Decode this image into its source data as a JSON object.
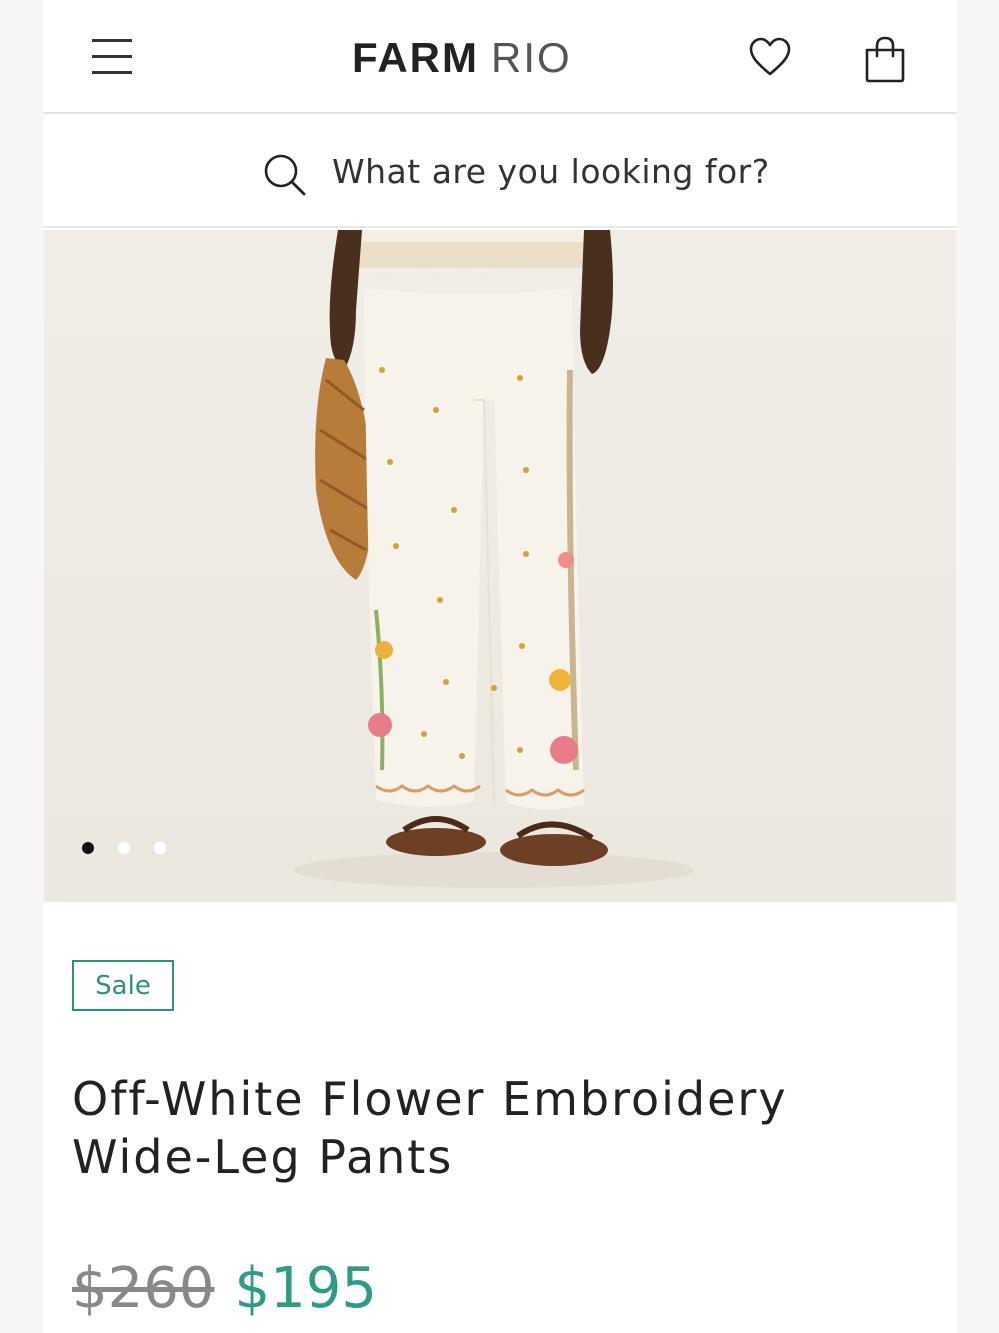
{
  "header": {
    "logo_primary": "FARM",
    "logo_secondary": "RIO",
    "menu_icon": "hamburger-menu-icon",
    "wishlist_icon": "heart-icon",
    "bag_icon": "shopping-bag-icon"
  },
  "search": {
    "placeholder": "What are you looking for?",
    "icon": "search-icon"
  },
  "gallery": {
    "image_count": 3,
    "active_index": 0
  },
  "product": {
    "badge": "Sale",
    "title": "Off-White Flower Embroidery Wide-Leg Pants",
    "original_price": "$260",
    "sale_price": "$195"
  },
  "colors": {
    "accent": "#2f9a85",
    "badge_border": "#2f8f80",
    "text": "#222222"
  }
}
